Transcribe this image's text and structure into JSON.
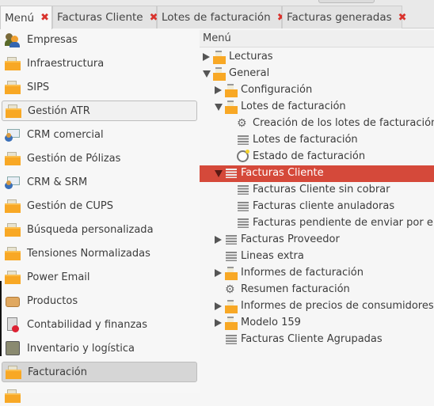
{
  "tabs": [
    {
      "label": "Menú",
      "active": true
    },
    {
      "label": "Facturas Cliente",
      "active": false
    },
    {
      "label": "Lotes de facturación",
      "active": false
    },
    {
      "label": "Facturas generadas",
      "active": false
    }
  ],
  "close_glyph": "✖",
  "left_menu": [
    {
      "label": "Empresas",
      "icon": "users-icon"
    },
    {
      "label": "Infraestructura",
      "icon": "folder-icon"
    },
    {
      "label": "SIPS",
      "icon": "folder-icon"
    },
    {
      "label": "Gestión ATR",
      "icon": "folder-icon",
      "boxed": true
    },
    {
      "label": "CRM comercial",
      "icon": "crm-icon"
    },
    {
      "label": "Gestión de Pólizas",
      "icon": "folder-icon"
    },
    {
      "label": "CRM & SRM",
      "icon": "crm-icon"
    },
    {
      "label": "Gestión de CUPS",
      "icon": "folder-icon"
    },
    {
      "label": "Búsqueda personalizada",
      "icon": "folder-icon"
    },
    {
      "label": "Tensiones Normalizadas",
      "icon": "folder-icon"
    },
    {
      "label": "Power Email",
      "icon": "folder-icon"
    },
    {
      "label": "Productos",
      "icon": "box-icon"
    },
    {
      "label": "Contabilidad y finanzas",
      "icon": "accounting-icon"
    },
    {
      "label": "Inventario y logística",
      "icon": "inventory-icon"
    },
    {
      "label": "Facturación",
      "icon": "folder-icon",
      "boxed": true,
      "selected": true
    }
  ],
  "tree": {
    "header": "Menú",
    "rows": [
      {
        "label": "Lecturas",
        "level": 0,
        "arrow": "right",
        "icon": "folder-icon"
      },
      {
        "label": "General",
        "level": 0,
        "arrow": "down",
        "icon": "folder-icon"
      },
      {
        "label": "Configuración",
        "level": 1,
        "arrow": "right",
        "icon": "folder-icon"
      },
      {
        "label": "Lotes de facturación",
        "level": 1,
        "arrow": "down",
        "icon": "folder-icon"
      },
      {
        "label": "Creación de los lotes de facturación",
        "level": 2,
        "arrow": "none",
        "icon": "gears-icon"
      },
      {
        "label": "Lotes de facturación",
        "level": 2,
        "arrow": "none",
        "icon": "list-icon"
      },
      {
        "label": "Estado de facturación",
        "level": 2,
        "arrow": "none",
        "icon": "clock-icon"
      },
      {
        "label": "Facturas Cliente",
        "level": 1,
        "arrow": "down",
        "icon": "list-icon",
        "selected": true
      },
      {
        "label": "Facturas Cliente sin cobrar",
        "level": 2,
        "arrow": "none",
        "icon": "list-icon"
      },
      {
        "label": "Facturas cliente anuladoras",
        "level": 2,
        "arrow": "none",
        "icon": "list-icon"
      },
      {
        "label": "Facturas pendiente de enviar por email",
        "level": 2,
        "arrow": "none",
        "icon": "list-icon"
      },
      {
        "label": "Facturas Proveedor",
        "level": 1,
        "arrow": "right",
        "icon": "list-icon"
      },
      {
        "label": "Lineas extra",
        "level": 1,
        "arrow": "none",
        "icon": "list-icon"
      },
      {
        "label": "Informes de facturación",
        "level": 1,
        "arrow": "right",
        "icon": "folder-icon"
      },
      {
        "label": "Resumen facturación",
        "level": 1,
        "arrow": "none",
        "icon": "gears-icon"
      },
      {
        "label": "Informes de precios de consumidores",
        "level": 1,
        "arrow": "right",
        "icon": "folder-icon"
      },
      {
        "label": "Modelo 159",
        "level": 1,
        "arrow": "right",
        "icon": "folder-icon"
      },
      {
        "label": "Facturas Cliente Agrupadas",
        "level": 1,
        "arrow": "none",
        "icon": "list-icon"
      }
    ]
  },
  "colors": {
    "selected_row": "#d5493a",
    "close": "#d9322c",
    "folder": "#f8a825"
  }
}
